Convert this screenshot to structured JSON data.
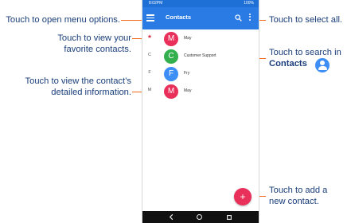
{
  "callouts": {
    "menu": "Touch to open menu options.",
    "favorites_line1": "Touch to view your",
    "favorites_line2": "favorite contacts.",
    "details_line1": "Touch to view the contact’s",
    "details_line2": "detailed information.",
    "select_all": "Touch to select all.",
    "search_line1": "Touch to search in",
    "search_line2": "Contacts",
    "add_line1": "Touch to add a",
    "add_line2": "new contact."
  },
  "status_bar": {
    "time": "8:02PM",
    "battery": "100%"
  },
  "app_bar": {
    "title": "Contacts",
    "menu_icon": "hamburger-menu-icon",
    "search_icon": "search-icon",
    "more_icon": "more-vertical-icon"
  },
  "contacts": [
    {
      "prefix": "★",
      "initial": "M",
      "name": "May",
      "avatar_color": "#e8305a"
    },
    {
      "prefix": "C",
      "initial": "C",
      "name": "Customer Support",
      "avatar_color": "#33b04d"
    },
    {
      "prefix": "F",
      "initial": "F",
      "name": "Fry",
      "avatar_color": "#3d8ef5"
    },
    {
      "prefix": "M",
      "initial": "M",
      "name": "May",
      "avatar_color": "#e8305a"
    }
  ],
  "fab": {
    "label": "+",
    "icon": "plus-icon"
  },
  "colors": {
    "app_bar": "#2a7be4",
    "status_bar": "#1e6fd6",
    "callout_text": "#1a3e7a",
    "callout_line": "#f26a1b",
    "fab": "#e8305a"
  }
}
